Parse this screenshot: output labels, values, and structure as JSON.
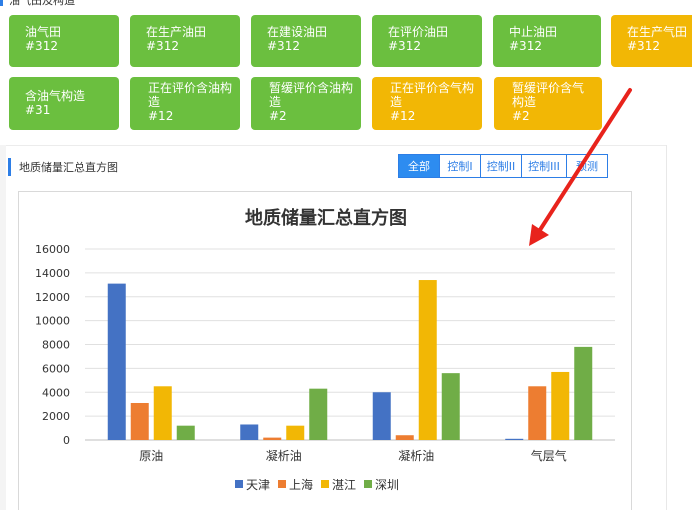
{
  "header": {
    "title": "油气田及构造"
  },
  "cards": [
    {
      "name": "油气田",
      "count": "#312",
      "color": "green"
    },
    {
      "name": "在生产油田",
      "count": "#312",
      "color": "green"
    },
    {
      "name": "在建设油田",
      "count": "#312",
      "color": "green"
    },
    {
      "name": "在评价油田",
      "count": "#312",
      "color": "green"
    },
    {
      "name": "中止油田",
      "count": "#312",
      "color": "green"
    },
    {
      "name": "在生产气田",
      "count": "#312",
      "color": "yellow"
    },
    {
      "name": "含油气构造",
      "count": "#31",
      "color": "green"
    },
    {
      "name": "正在评价含油构造",
      "count": "#12",
      "color": "green"
    },
    {
      "name": "暂缓评价含油构造",
      "count": "#2",
      "color": "green"
    },
    {
      "name": "正在评价含气构造",
      "count": "#12",
      "color": "yellow"
    },
    {
      "name": "暂缓评价含气构造",
      "count": "#2",
      "color": "yellow"
    }
  ],
  "section": {
    "title": "地质储量汇总直方图"
  },
  "tabs": [
    {
      "label": "全部",
      "active": true
    },
    {
      "label": "控制I",
      "active": false
    },
    {
      "label": "控制II",
      "active": false
    },
    {
      "label": "控制III",
      "active": false
    },
    {
      "label": "预测",
      "active": false
    }
  ],
  "colors": {
    "green": "#6bbf3f",
    "yellow": "#f2b705",
    "accent": "#2d8cf0",
    "arrow": "#e8231c"
  },
  "chart_data": {
    "type": "bar",
    "title": "地质储量汇总直方图",
    "categories": [
      "原油",
      "凝析油",
      "凝析油",
      "气层气"
    ],
    "series": [
      {
        "name": "天津",
        "color": "#4472c4",
        "values": [
          13100,
          1300,
          4000,
          100
        ]
      },
      {
        "name": "上海",
        "color": "#ed7d31",
        "values": [
          3100,
          200,
          400,
          4500
        ]
      },
      {
        "name": "湛江",
        "color": "#f2b705",
        "values": [
          4500,
          1200,
          13400,
          5700
        ]
      },
      {
        "name": "深圳",
        "color": "#70ad47",
        "values": [
          1200,
          4300,
          5600,
          7800
        ]
      }
    ],
    "ylim": [
      0,
      16000
    ],
    "yticks": [
      "0",
      "2000",
      "4000",
      "6000",
      "8000",
      "10000",
      "12000",
      "14000",
      "16000"
    ],
    "grid": true,
    "legend": "bottom"
  }
}
